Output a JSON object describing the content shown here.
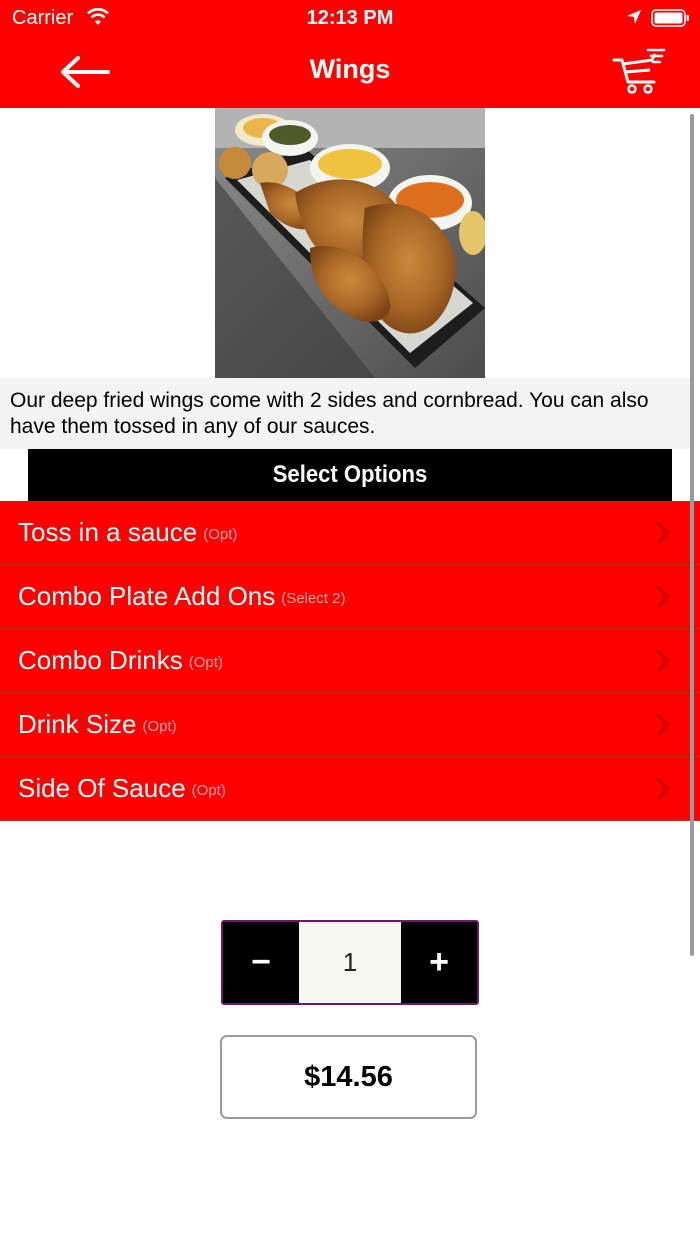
{
  "status_bar": {
    "carrier": "Carrier",
    "time": "12:13 PM"
  },
  "nav": {
    "title": "Wings",
    "back_icon": "arrow-left-icon",
    "cart_icon": "shopping-cart-icon"
  },
  "item": {
    "image_alt": "Fried wings plate",
    "description": "Our deep fried wings come with 2 sides and cornbread. You can also have them tossed in any of our sauces."
  },
  "options_header": "Select Options",
  "options": [
    {
      "label": "Toss in a sauce",
      "tag": "(Opt)"
    },
    {
      "label": "Combo Plate Add Ons",
      "tag": "(Select 2)"
    },
    {
      "label": "Combo Drinks",
      "tag": "(Opt)"
    },
    {
      "label": "Drink Size",
      "tag": "(Opt)"
    },
    {
      "label": "Side Of Sauce",
      "tag": "(Opt)"
    }
  ],
  "quantity": {
    "minus": "−",
    "value": "1",
    "plus": "+"
  },
  "price": "$14.56",
  "colors": {
    "brand_red": "#ff0000",
    "header_black": "#000000"
  }
}
